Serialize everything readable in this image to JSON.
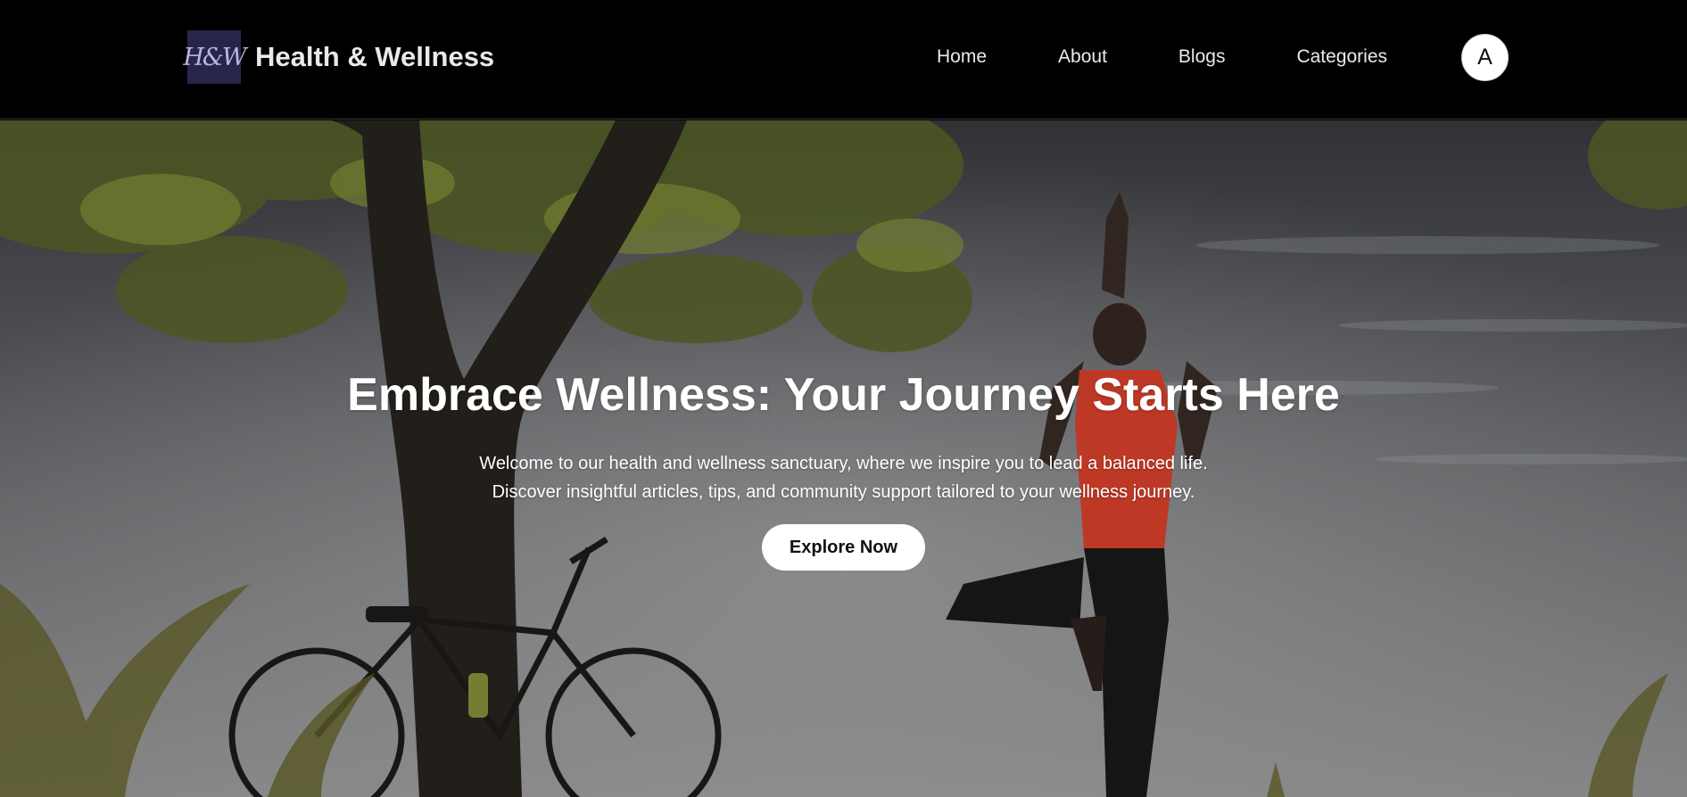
{
  "brand": {
    "logo_text": "H&W",
    "name": "Health & Wellness",
    "logo_color": "#27264a"
  },
  "nav": {
    "items": [
      {
        "label": "Home"
      },
      {
        "label": "About"
      },
      {
        "label": "Blogs"
      },
      {
        "label": "Categories"
      }
    ],
    "avatar_initial": "A"
  },
  "hero": {
    "title": "Embrace Wellness: Your Journey Starts Here",
    "subtitle_lines": [
      "Welcome to our health and wellness sanctuary, where we inspire you to lead a balanced life.",
      "Discover insightful articles, tips, and community support tailored to your wellness journey."
    ],
    "cta_label": "Explore Now",
    "background_image": "yoga-outdoor-tree-bicycle-photo",
    "accent_shirt_color": "#e8452f"
  }
}
